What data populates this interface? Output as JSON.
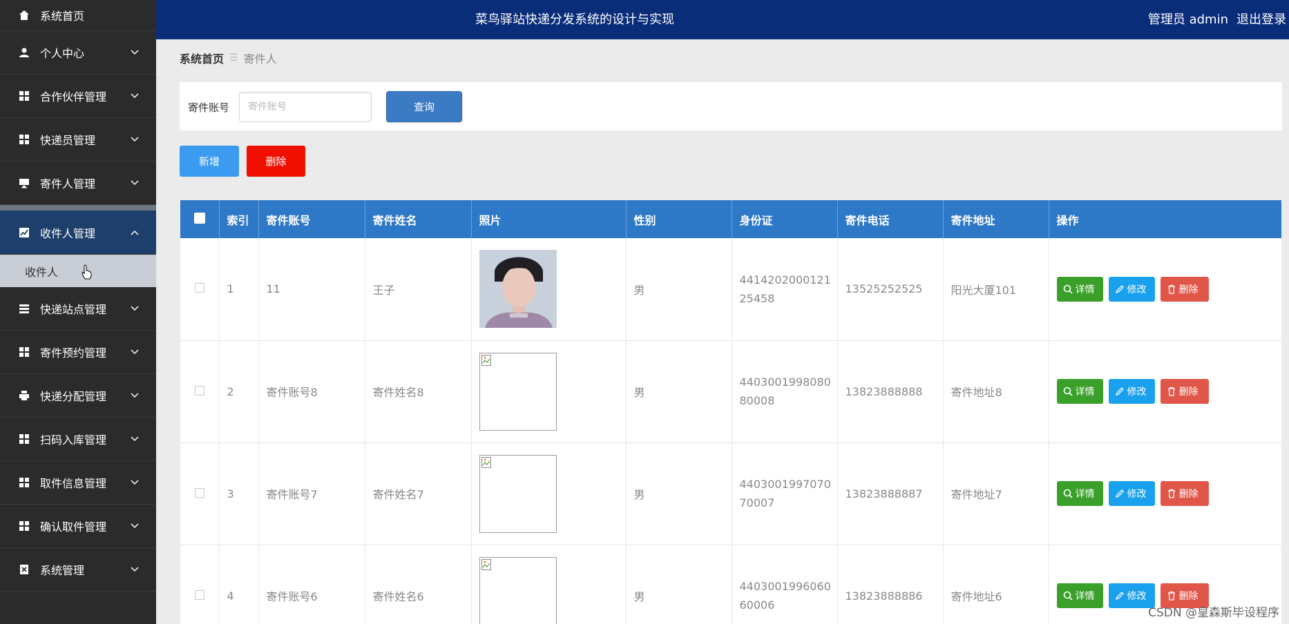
{
  "sidebar": {
    "items": [
      {
        "label": "系统首页",
        "icon": "home-icon"
      },
      {
        "label": "个人中心",
        "icon": "user-icon"
      },
      {
        "label": "合作伙伴管理",
        "icon": "grid-icon"
      },
      {
        "label": "快递员管理",
        "icon": "grid-icon"
      },
      {
        "label": "寄件人管理",
        "icon": "monitor-icon"
      },
      {
        "label": "收件人管理",
        "icon": "chart-icon"
      },
      {
        "label": "快递站点管理",
        "icon": "list-icon"
      },
      {
        "label": "寄件预约管理",
        "icon": "grid-icon"
      },
      {
        "label": "快递分配管理",
        "icon": "printer-icon"
      },
      {
        "label": "扫码入库管理",
        "icon": "grid-icon"
      },
      {
        "label": "取件信息管理",
        "icon": "grid-icon"
      },
      {
        "label": "确认取件管理",
        "icon": "grid-icon"
      },
      {
        "label": "系统管理",
        "icon": "close-box-icon"
      }
    ],
    "active_sub": "收件人"
  },
  "header": {
    "title": "菜鸟驿站快递分发系统的设计与实现",
    "user": "管理员 admin",
    "logout": "退出登录"
  },
  "breadcrumb": {
    "home": "系统首页",
    "current": "寄件人"
  },
  "search": {
    "label": "寄件账号",
    "placeholder": "寄件账号",
    "value": "",
    "button": "查询"
  },
  "actions": {
    "add": "新增",
    "delete": "删除"
  },
  "table": {
    "columns": [
      "索引",
      "寄件账号",
      "寄件姓名",
      "照片",
      "性别",
      "身份证",
      "寄件电话",
      "寄件地址",
      "操作"
    ],
    "rows": [
      {
        "index": "1",
        "account": "11",
        "name": "王子",
        "gender": "男",
        "id_card": "441420200012125458",
        "phone": "13525252525",
        "address": "阳光大厦101",
        "photo": "portrait"
      },
      {
        "index": "2",
        "account": "寄件账号8",
        "name": "寄件姓名8",
        "gender": "男",
        "id_card": "440300199808080008",
        "phone": "13823888888",
        "address": "寄件地址8",
        "photo": "broken"
      },
      {
        "index": "3",
        "account": "寄件账号7",
        "name": "寄件姓名7",
        "gender": "男",
        "id_card": "440300199707070007",
        "phone": "13823888887",
        "address": "寄件地址7",
        "photo": "broken"
      },
      {
        "index": "4",
        "account": "寄件账号6",
        "name": "寄件姓名6",
        "gender": "男",
        "id_card": "440300199606060006",
        "phone": "13823888886",
        "address": "寄件地址6",
        "photo": "broken"
      }
    ],
    "ops": {
      "detail": "详情",
      "edit": "修改",
      "remove": "删除"
    }
  },
  "watermark": "CSDN @皇森斯毕设程序",
  "colors": {
    "header_bg": "#0a2d7a",
    "sidebar_bg": "#2b2b2b",
    "table_header": "#2e78c8",
    "detail_btn": "#3aa02a",
    "edit_btn": "#1aa1ee",
    "remove_btn": "#e0574a"
  }
}
